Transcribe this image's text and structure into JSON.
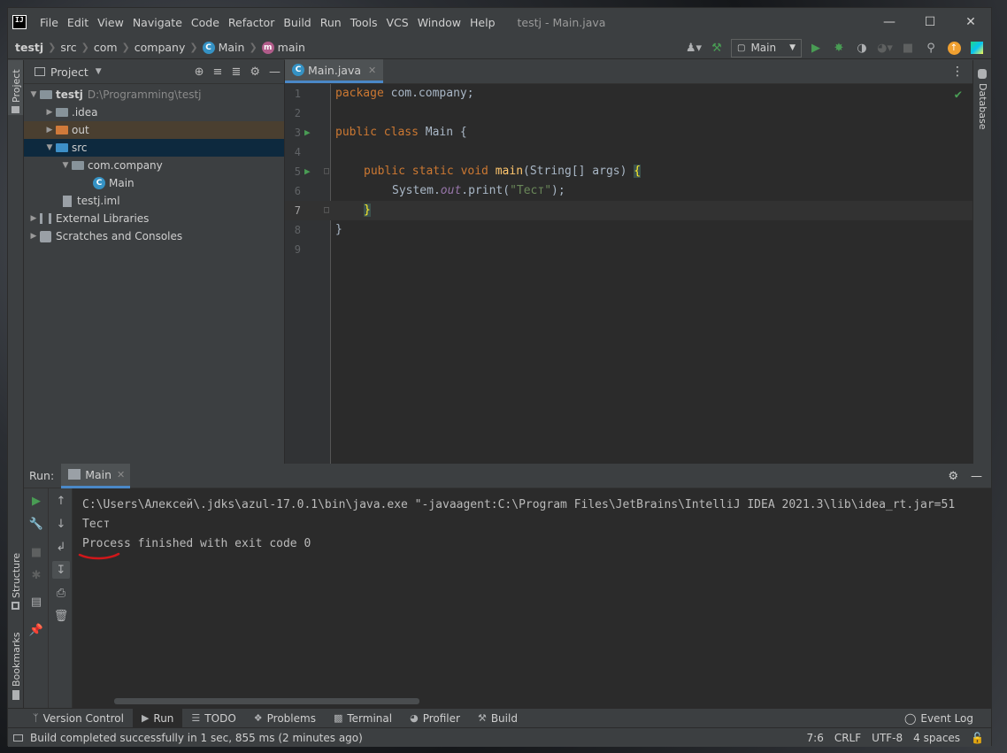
{
  "window": {
    "title": "testj - Main.java",
    "logo": "IJ"
  },
  "menu": [
    "File",
    "Edit",
    "View",
    "Navigate",
    "Code",
    "Refactor",
    "Build",
    "Run",
    "Tools",
    "VCS",
    "Window",
    "Help"
  ],
  "breadcrumb": {
    "items": [
      "testj",
      "src",
      "com",
      "company",
      "Main",
      "main"
    ]
  },
  "toolbar": {
    "run_config": "Main"
  },
  "stripes": {
    "project": "Project",
    "structure": "Structure",
    "bookmarks": "Bookmarks",
    "database": "Database"
  },
  "project_panel": {
    "title": "Project",
    "tree": [
      {
        "label": "testj",
        "hint": "D:\\Programming\\testj"
      },
      {
        "label": ".idea"
      },
      {
        "label": "out"
      },
      {
        "label": "src"
      },
      {
        "label": "com.company"
      },
      {
        "label": "Main"
      },
      {
        "label": "testj.iml"
      },
      {
        "label": "External Libraries"
      },
      {
        "label": "Scratches and Consoles"
      }
    ]
  },
  "editor": {
    "tab": "Main.java",
    "line_numbers": [
      "1",
      "2",
      "3",
      "4",
      "5",
      "6",
      "7",
      "8",
      "9"
    ],
    "code": {
      "l1_kw": "package",
      "l1_rest": " com.company;",
      "l3_kw": "public class",
      "l3_rest": " Main {",
      "l5_kw": "public static void",
      "l5_fn": "main",
      "l5_rest": "(String[] args) ",
      "l5_brace": "{",
      "l6_pre": "System.",
      "l6_it": "out",
      "l6_mid": ".print(",
      "l6_str": "\"Тест\"",
      "l6_end": ");",
      "l7_brace": "}",
      "l8": "}"
    }
  },
  "run_panel": {
    "label": "Run:",
    "tab": "Main",
    "console": [
      "C:\\Users\\Алексей\\.jdks\\azul-17.0.1\\bin\\java.exe \"-javaagent:C:\\Program Files\\JetBrains\\IntelliJ IDEA 2021.3\\lib\\idea_rt.jar=51",
      "Тест",
      "Process finished with exit code 0"
    ]
  },
  "bottom_tabs": [
    "Version Control",
    "Run",
    "TODO",
    "Problems",
    "Terminal",
    "Profiler",
    "Build"
  ],
  "event_log": "Event Log",
  "status": {
    "message": "Build completed successfully in 1 sec, 855 ms (2 minutes ago)",
    "position": "7:6",
    "line_sep": "CRLF",
    "encoding": "UTF-8",
    "indent": "4 spaces"
  },
  "colors": {
    "accent": "#4a88c7",
    "run_green": "#499c54",
    "annotation_red": "#d0171a"
  }
}
